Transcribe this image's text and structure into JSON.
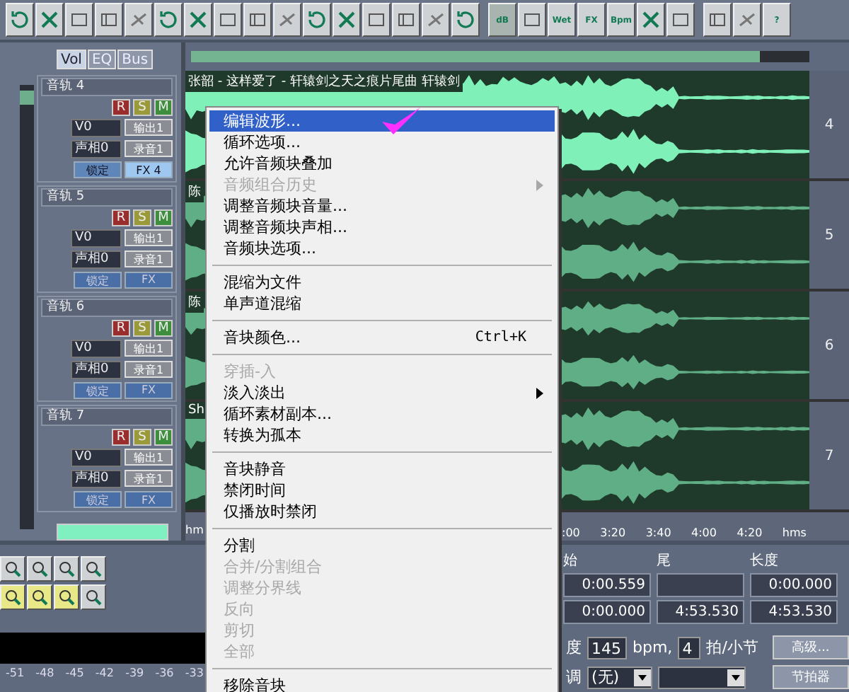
{
  "toolbar": {
    "groups": [
      [
        {
          "kind": "icon"
        },
        {
          "kind": "icon"
        },
        {
          "kind": "icon"
        },
        {
          "kind": "icon"
        },
        {
          "kind": "icon"
        },
        {
          "kind": "icon"
        },
        {
          "kind": "icon"
        },
        {
          "kind": "icon"
        },
        {
          "kind": "icon"
        },
        {
          "kind": "icon"
        },
        {
          "kind": "icon"
        },
        {
          "kind": "icon"
        },
        {
          "kind": "icon"
        },
        {
          "kind": "icon"
        },
        {
          "kind": "icon"
        },
        {
          "kind": "icon"
        }
      ],
      [
        {
          "kind": "text",
          "label": "dB",
          "selected": true
        },
        {
          "kind": "icon",
          "selected": false
        },
        {
          "kind": "text",
          "label": "Wet",
          "selected": false
        },
        {
          "kind": "text",
          "label": "FX",
          "selected": false
        },
        {
          "kind": "text",
          "label": "Bpm",
          "selected": false
        },
        {
          "kind": "icon",
          "selected": false
        },
        {
          "kind": "icon",
          "selected": false
        }
      ],
      [
        {
          "kind": "icon"
        },
        {
          "kind": "icon"
        },
        {
          "kind": "text",
          "label": "?"
        }
      ]
    ]
  },
  "track_tabs": [
    {
      "label": "Vol",
      "selected": true
    },
    {
      "label": "EQ",
      "selected": false
    },
    {
      "label": "Bus",
      "selected": false
    }
  ],
  "tracks": [
    {
      "title": "音轨 4",
      "number": "4",
      "selected": true,
      "volume": "V0",
      "pan": "声相0",
      "output": "输出1",
      "record": "录音1",
      "lock": "锁定",
      "fx": "FX 4",
      "clip_title": "张韶 - 这样爱了 - 轩辕剑之天之痕片尾曲 轩辕剑",
      "toggles": [
        "R",
        "S",
        "M"
      ]
    },
    {
      "title": "音轨 5",
      "number": "5",
      "selected": false,
      "volume": "V0",
      "pan": "声相0",
      "output": "输出1",
      "record": "录音1",
      "lock": "锁定",
      "fx": "FX",
      "clip_title": "陈",
      "toggles": [
        "R",
        "S",
        "M"
      ]
    },
    {
      "title": "音轨 6",
      "number": "6",
      "selected": false,
      "volume": "V0",
      "pan": "声相0",
      "output": "输出1",
      "record": "录音1",
      "lock": "锁定",
      "fx": "FX",
      "clip_title": "陈",
      "toggles": [
        "R",
        "S",
        "M"
      ]
    },
    {
      "title": "音轨 7",
      "number": "7",
      "selected": false,
      "volume": "V0",
      "pan": "声相0",
      "output": "输出1",
      "record": "录音1",
      "lock": "锁定",
      "fx": "FX",
      "clip_title": "Sh",
      "toggles": [
        "R",
        "S",
        "M"
      ]
    }
  ],
  "overview": {
    "level": 0.92
  },
  "ruler": {
    "left": "hm",
    "labels": [
      ":00",
      "3:20",
      "3:40",
      "4:00",
      "4:20"
    ],
    "unit": "hms"
  },
  "selection": {
    "columns": [
      "始",
      "尾",
      "长度"
    ],
    "rows": [
      [
        "0:00.559",
        "",
        "0:00.000"
      ],
      [
        "0:00.000",
        "4:53.530",
        "4:53.530"
      ]
    ]
  },
  "tempo": {
    "label": "度",
    "bpm": "145",
    "unit": "bpm,",
    "beats": "4",
    "beats_label": "拍/小节",
    "advanced": "高级..."
  },
  "key": {
    "label": "调",
    "value": "(无)",
    "metronome": "节拍器"
  },
  "meter": {
    "ticks": [
      "-51",
      "-48",
      "-45",
      "-42",
      "-39",
      "-36",
      "-33"
    ]
  },
  "context_menu": {
    "groups": [
      [
        {
          "label": "编辑波形...",
          "selected": true,
          "disabled": false
        },
        {
          "label": "循环选项...",
          "selected": false,
          "disabled": false
        },
        {
          "label": "允许音频块叠加",
          "selected": false,
          "disabled": false
        },
        {
          "label": "音频组合历史",
          "selected": false,
          "disabled": true,
          "submenu": true
        },
        {
          "label": "调整音频块音量...",
          "selected": false,
          "disabled": false
        },
        {
          "label": "调整音频块声相...",
          "selected": false,
          "disabled": false
        },
        {
          "label": "音频块选项...",
          "selected": false,
          "disabled": false
        }
      ],
      [
        {
          "label": "混缩为文件",
          "selected": false,
          "disabled": false
        },
        {
          "label": "单声道混缩",
          "selected": false,
          "disabled": false
        }
      ],
      [
        {
          "label": "音块颜色...",
          "selected": false,
          "disabled": false,
          "shortcut": "Ctrl+K"
        }
      ],
      [
        {
          "label": "穿插-入",
          "selected": false,
          "disabled": true
        },
        {
          "label": "淡入淡出",
          "selected": false,
          "disabled": false,
          "submenu": true
        },
        {
          "label": "循环素材副本...",
          "selected": false,
          "disabled": false
        },
        {
          "label": "转换为孤本",
          "selected": false,
          "disabled": false
        }
      ],
      [
        {
          "label": "音块静音",
          "selected": false,
          "disabled": false
        },
        {
          "label": "禁闭时间",
          "selected": false,
          "disabled": false
        },
        {
          "label": "仅播放时禁闭",
          "selected": false,
          "disabled": false
        }
      ],
      [
        {
          "label": "分割",
          "selected": false,
          "disabled": false
        },
        {
          "label": "合并/分割组合",
          "selected": false,
          "disabled": true
        },
        {
          "label": "调整分界线",
          "selected": false,
          "disabled": true
        },
        {
          "label": "反向",
          "selected": false,
          "disabled": true
        },
        {
          "label": "剪切",
          "selected": false,
          "disabled": true
        },
        {
          "label": "全部",
          "selected": false,
          "disabled": true
        }
      ],
      [
        {
          "label": "移除音块",
          "selected": false,
          "disabled": false
        }
      ]
    ]
  }
}
